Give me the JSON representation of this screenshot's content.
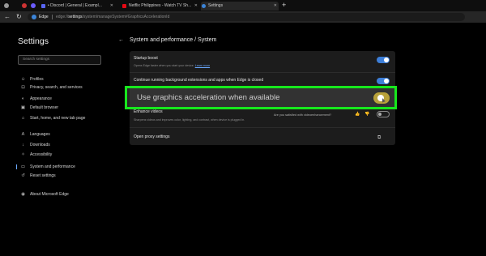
{
  "tabs": [
    {
      "label": "",
      "color": "#c33"
    },
    {
      "label": "",
      "color": "#6b5cff"
    },
    {
      "label": "• Discord | General | Exampl...",
      "color": "#5865f2"
    },
    {
      "label": "Netflix Philippines - Watch TV Sh...",
      "color": "#e50914"
    },
    {
      "label": "Settings",
      "color": "#3b84d8"
    }
  ],
  "newtab_label": "+",
  "address": {
    "browser_label": "Edge",
    "url_scheme": "edge://",
    "url_host": "settings",
    "url_path": "/system/manageSystem#GraphicsAccelerationId"
  },
  "sidebar": {
    "title": "Settings",
    "search_placeholder": "Search settings",
    "items": [
      {
        "label": "Profiles",
        "icon": "person-icon",
        "glyph": "☺"
      },
      {
        "label": "Privacy, search, and services",
        "icon": "lock-icon",
        "glyph": "⊡"
      },
      {
        "label": "Appearance",
        "icon": "palette-icon",
        "glyph": "◐"
      },
      {
        "label": "Default browser",
        "icon": "browser-icon",
        "glyph": "▣"
      },
      {
        "label": "Start, home, and new tab page",
        "icon": "home-icon",
        "glyph": "⌂"
      },
      {
        "label": "Languages",
        "icon": "language-icon",
        "glyph": "A"
      },
      {
        "label": "Downloads",
        "icon": "download-icon",
        "glyph": "↓"
      },
      {
        "label": "Accessibility",
        "icon": "accessibility-icon",
        "glyph": "✧"
      },
      {
        "label": "System and performance",
        "icon": "system-icon",
        "glyph": "▭",
        "selected": true
      },
      {
        "label": "Reset settings",
        "icon": "reset-icon",
        "glyph": "↺"
      },
      {
        "label": "About Microsoft Edge",
        "icon": "edge-logo-icon",
        "glyph": "◉"
      }
    ]
  },
  "main": {
    "title": "System and performance / System",
    "startup_boost": {
      "title": "Startup boost",
      "subtitle": "Opens Edge faster when you start your device.",
      "link": "Learn more",
      "on": true
    },
    "background_apps": {
      "title": "Continue running background extensions and apps when Edge is closed",
      "on": true
    },
    "graphics": {
      "title": "Use graphics acceleration when available",
      "on": true
    },
    "enhance_videos": {
      "title": "Enhance videos",
      "subtitle": "Sharpens videos and improves color, lighting, and contrast, when device is plugged in.",
      "feedback": "Are you satisfied with videoenhancement?",
      "on": false
    },
    "proxy": {
      "title": "Open proxy settings"
    }
  },
  "colors": {
    "accent": "#3d7fd9",
    "highlight": "#17e81d"
  }
}
